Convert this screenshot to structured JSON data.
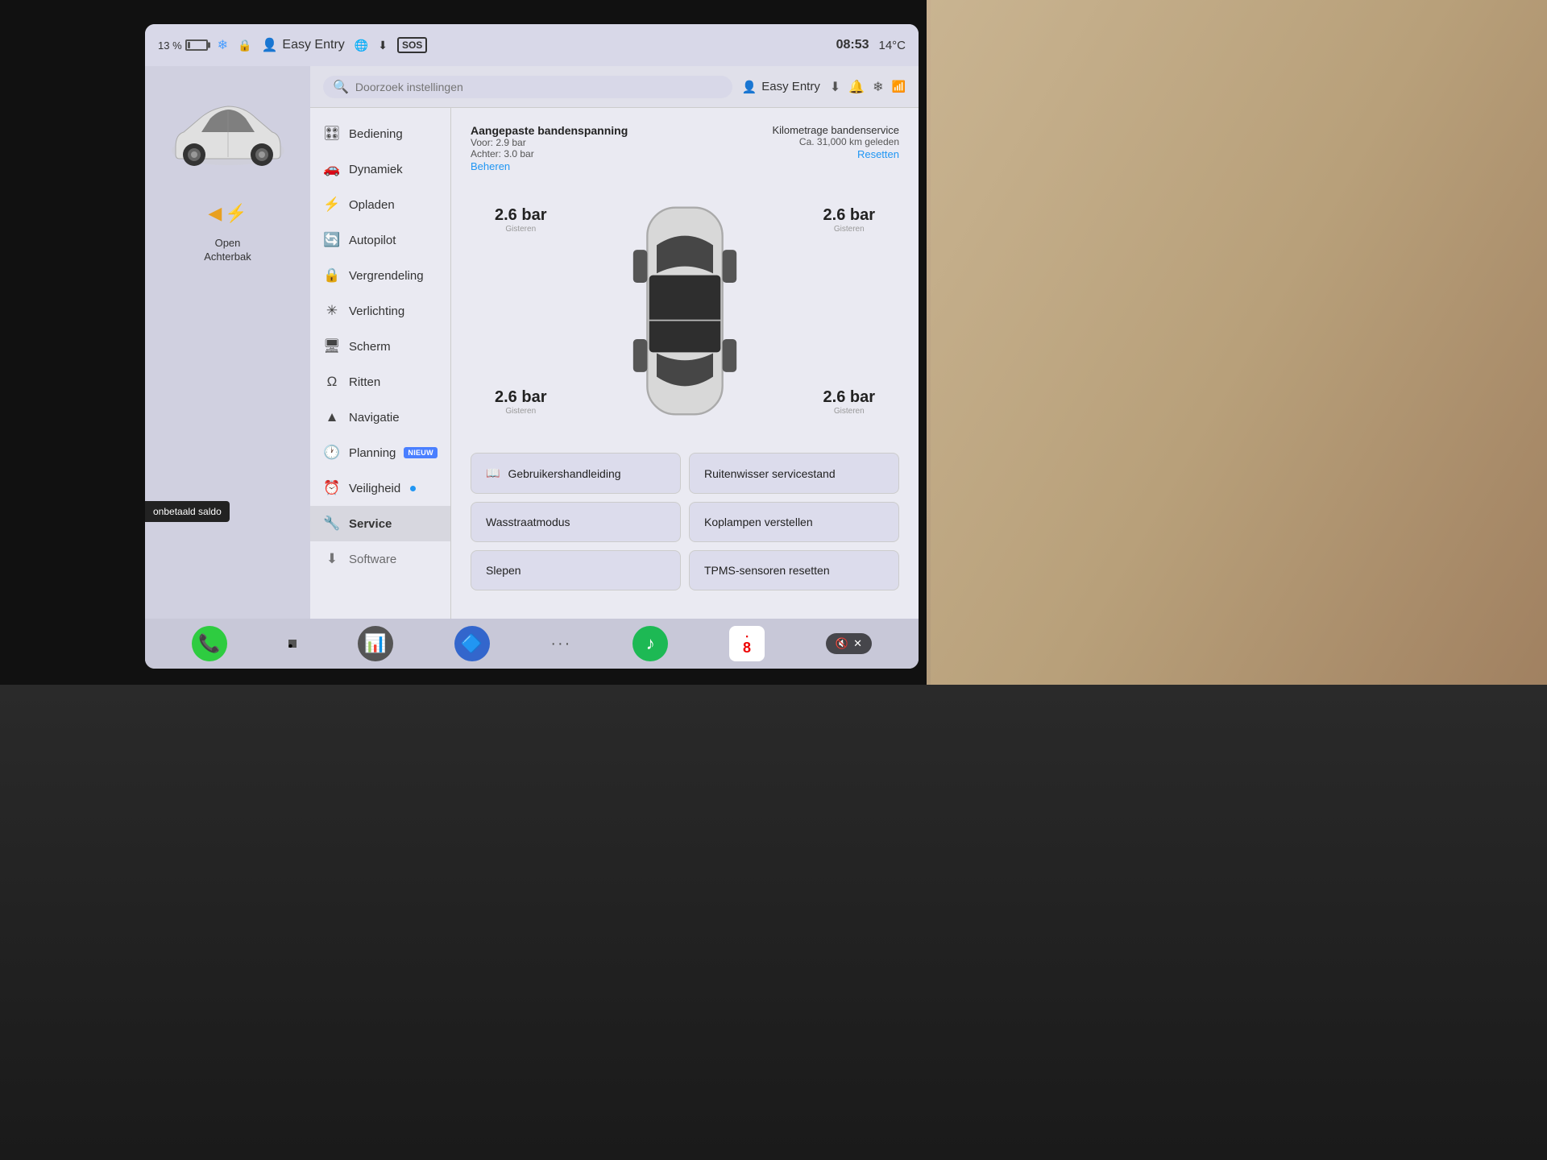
{
  "device": {
    "background": "#111"
  },
  "status_bar": {
    "battery_percent": "13 %",
    "time": "08:53",
    "temperature": "14°C",
    "profile_label": "Easy Entry",
    "sos_label": "SOS",
    "bluetooth_color": "#4a9eff"
  },
  "left_panel": {
    "open_label": "Open",
    "trunk_label": "Achterbak",
    "unpaid_label": "onbetaald saldo"
  },
  "search_header": {
    "placeholder": "Doorzoek instellingen",
    "profile_label": "Easy Entry"
  },
  "nav_items": [
    {
      "id": "bediening",
      "label": "Bediening",
      "icon": "🎛"
    },
    {
      "id": "dynamiek",
      "label": "Dynamiek",
      "icon": "🚗"
    },
    {
      "id": "opladen",
      "label": "Opladen",
      "icon": "⚡"
    },
    {
      "id": "autopilot",
      "label": "Autopilot",
      "icon": "🔄"
    },
    {
      "id": "vergrendeling",
      "label": "Vergrendeling",
      "icon": "🔒"
    },
    {
      "id": "verlichting",
      "label": "Verlichting",
      "icon": "💡"
    },
    {
      "id": "scherm",
      "label": "Scherm",
      "icon": "🖥"
    },
    {
      "id": "ritten",
      "label": "Ritten",
      "icon": "📍"
    },
    {
      "id": "navigatie",
      "label": "Navigatie",
      "icon": "▲"
    },
    {
      "id": "planning",
      "label": "Planning",
      "icon": "🕐",
      "badge": "NIEUW"
    },
    {
      "id": "veiligheid",
      "label": "Veiligheid",
      "icon": "🔔",
      "dot": true
    },
    {
      "id": "service",
      "label": "Service",
      "icon": "🔧",
      "active": true
    },
    {
      "id": "software",
      "label": "Software",
      "icon": "⬇"
    }
  ],
  "tire_section": {
    "title": "Aangepaste bandenspanning",
    "front_label": "Voor: 2.9 bar",
    "rear_label": "Achter: 3.0 bar",
    "manage_link": "Beheren",
    "service_title": "Kilometrage bandenservice",
    "service_value": "Ca. 31,000 km geleden",
    "reset_link": "Resetten",
    "info_icon": "ℹ"
  },
  "tire_pressures": {
    "front_left": {
      "value": "2.6 bar",
      "time": "Gisteren"
    },
    "front_right": {
      "value": "2.6 bar",
      "time": "Gisteren"
    },
    "rear_left": {
      "value": "2.6 bar",
      "time": "Gisteren"
    },
    "rear_right": {
      "value": "2.6 bar",
      "time": "Gisteren"
    }
  },
  "service_buttons": [
    {
      "id": "gebruikershandleiding",
      "label": "Gebruikershandleiding",
      "icon": "📖"
    },
    {
      "id": "ruitenwisser",
      "label": "Ruitenwisser servicestand",
      "icon": ""
    },
    {
      "id": "wasstraat",
      "label": "Wasstraatmodus",
      "icon": ""
    },
    {
      "id": "koplampen",
      "label": "Koplampen verstellen",
      "icon": ""
    },
    {
      "id": "slepen",
      "label": "Slepen",
      "icon": ""
    },
    {
      "id": "tpms",
      "label": "TPMS-sensoren resetten",
      "icon": ""
    }
  ],
  "taskbar": {
    "phone_label": "📞",
    "bluetooth_label": "Bluetooth",
    "spotify_label": "Spotify",
    "calendar_day": "8",
    "more_label": "···"
  },
  "volume": {
    "icon": "🔇",
    "close": "✕"
  }
}
